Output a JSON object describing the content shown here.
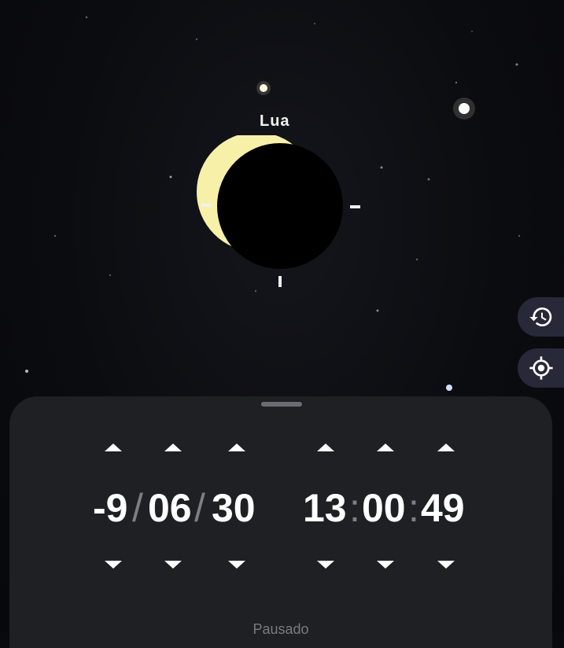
{
  "sky": {
    "object_label": "Lua"
  },
  "side_buttons": {
    "history_icon": "history-icon",
    "locate_icon": "crosshair-icon"
  },
  "datetime": {
    "year": "-9",
    "month": "06",
    "day": "30",
    "date_separator": "/",
    "hour": "13",
    "minute": "00",
    "second": "49",
    "time_separator": ":"
  },
  "status": "Pausado",
  "colors": {
    "moon_lit": "#f7f0a8",
    "panel": "#1f2023",
    "side_button": "#272838"
  }
}
